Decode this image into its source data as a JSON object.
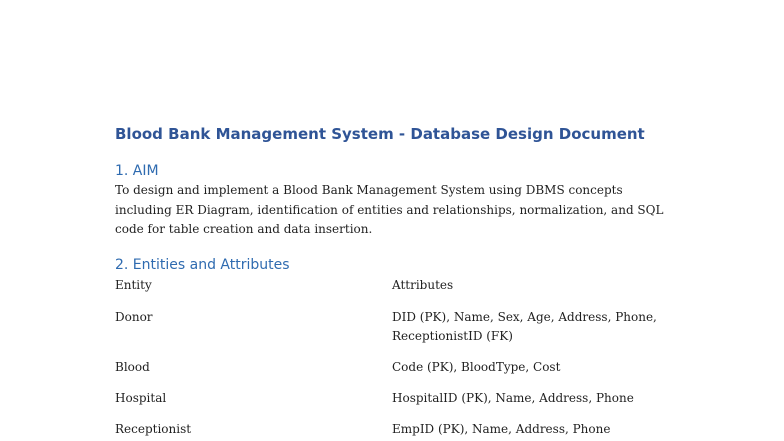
{
  "document": {
    "title": "Blood Bank Management System - Database Design Document",
    "sections": [
      {
        "heading": "1. AIM",
        "paragraph_lines": [
          "To design and implement a Blood Bank Management System using DBMS concepts",
          "including ER Diagram, identification of entities and relationships, normalization, and SQL",
          "code for table creation and data insertion."
        ]
      },
      {
        "heading": "2. Entities and Attributes",
        "table": {
          "headers": [
            "Entity",
            "Attributes"
          ],
          "rows": [
            {
              "entity": "Donor",
              "attributes": [
                "DID (PK), Name, Sex, Age, Address, Phone,",
                "ReceptionistID (FK)"
              ]
            },
            {
              "entity": "Blood",
              "attributes": [
                "Code (PK), BloodType, Cost"
              ]
            },
            {
              "entity": "Hospital",
              "attributes": [
                "HospitalID (PK), Name, Address, Phone"
              ]
            },
            {
              "entity": "Receptionist",
              "attributes": [
                "EmpID (PK), Name, Address, Phone"
              ]
            }
          ]
        }
      }
    ]
  },
  "colors": {
    "title": "#2f5496",
    "heading": "#2f6bb0",
    "body_text": "#1f1f1f"
  }
}
